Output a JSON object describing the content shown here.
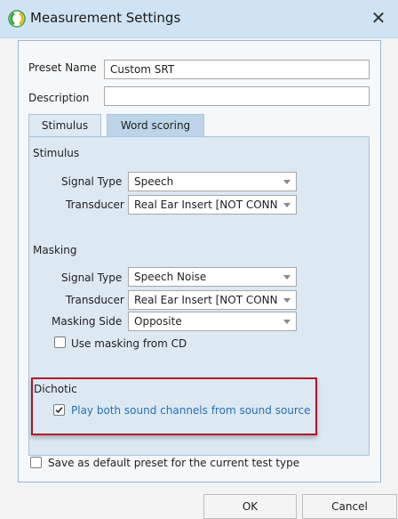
{
  "window": {
    "title": "Measurement Settings",
    "close_glyph": "✕"
  },
  "preset": {
    "label": "Preset Name",
    "value": "Custom SRT"
  },
  "description": {
    "label": "Description",
    "value": ""
  },
  "tabs": [
    {
      "label": "Stimulus",
      "active": true
    },
    {
      "label": "Word scoring",
      "active": false
    }
  ],
  "stimulus": {
    "heading": "Stimulus",
    "signal_type_label": "Signal Type",
    "signal_type_value": "Speech",
    "transducer_label": "Transducer",
    "transducer_value": "Real Ear Insert [NOT CONN"
  },
  "masking": {
    "heading": "Masking",
    "signal_type_label": "Signal Type",
    "signal_type_value": "Speech Noise",
    "transducer_label": "Transducer",
    "transducer_value": "Real Ear Insert [NOT CONN",
    "side_label": "Masking Side",
    "side_value": "Opposite",
    "use_cd_label": "Use masking from CD",
    "use_cd_checked": false
  },
  "dichotic": {
    "heading": "Dichotic",
    "play_both_label": "Play both sound channels from sound source",
    "play_both_checked": true
  },
  "save_default": {
    "label": "Save as default preset for the current test type",
    "checked": false
  },
  "buttons": {
    "ok": "OK",
    "cancel": "Cancel"
  },
  "colors": {
    "titlebar": "#cfe3f2",
    "panel": "#dce8f2",
    "tab_inactive": "#bdd4e8",
    "highlight_border": "#b3112a",
    "link_text": "#2a6fb5"
  },
  "icons": {
    "app": "app-logo-icon",
    "dropdown": "chevron-down-icon",
    "check": "checkmark-icon"
  }
}
